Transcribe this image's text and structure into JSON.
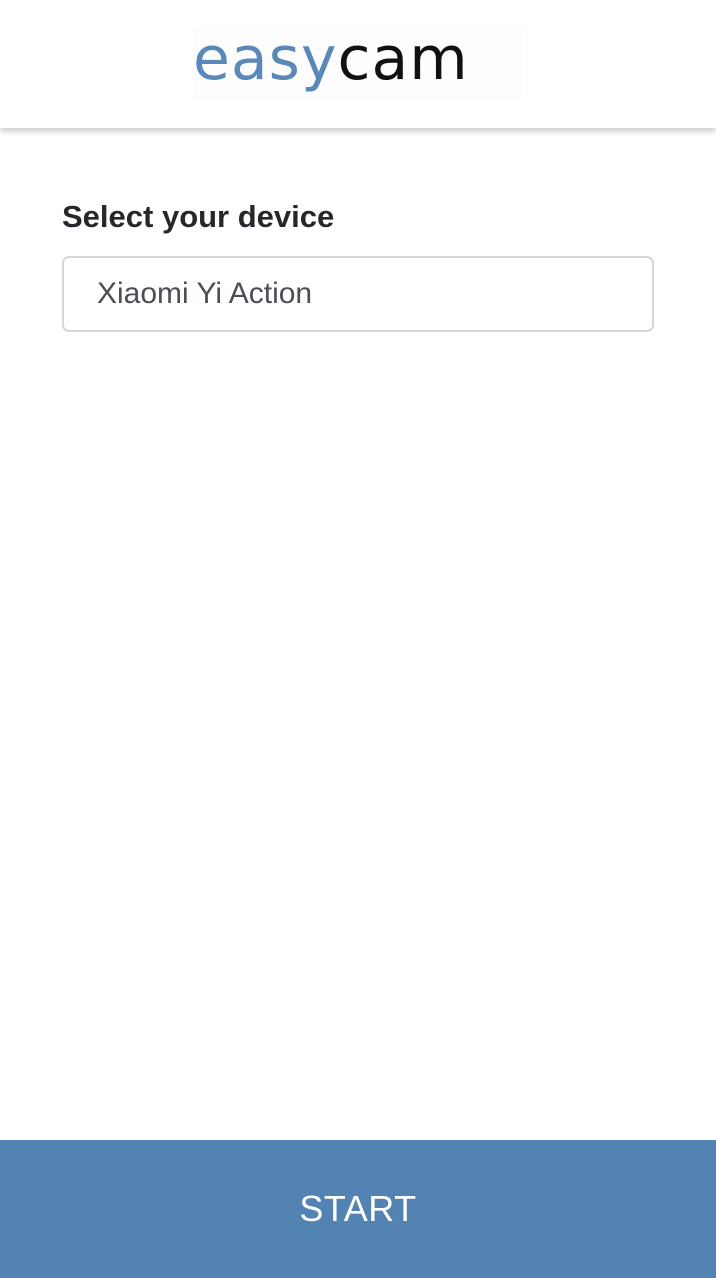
{
  "logo": {
    "text_part_1": "easy",
    "text_part_2": "cam",
    "color_part_1": "#5a88b8",
    "color_part_2": "#111111"
  },
  "form": {
    "label": "Select your device",
    "device_select": {
      "selected_value": "Xiaomi Yi Action"
    }
  },
  "footer": {
    "start_label": "START"
  },
  "colors": {
    "accent": "#5283b3",
    "background": "#ffffff",
    "label_text": "#24272b",
    "input_border": "#d4d7da"
  }
}
